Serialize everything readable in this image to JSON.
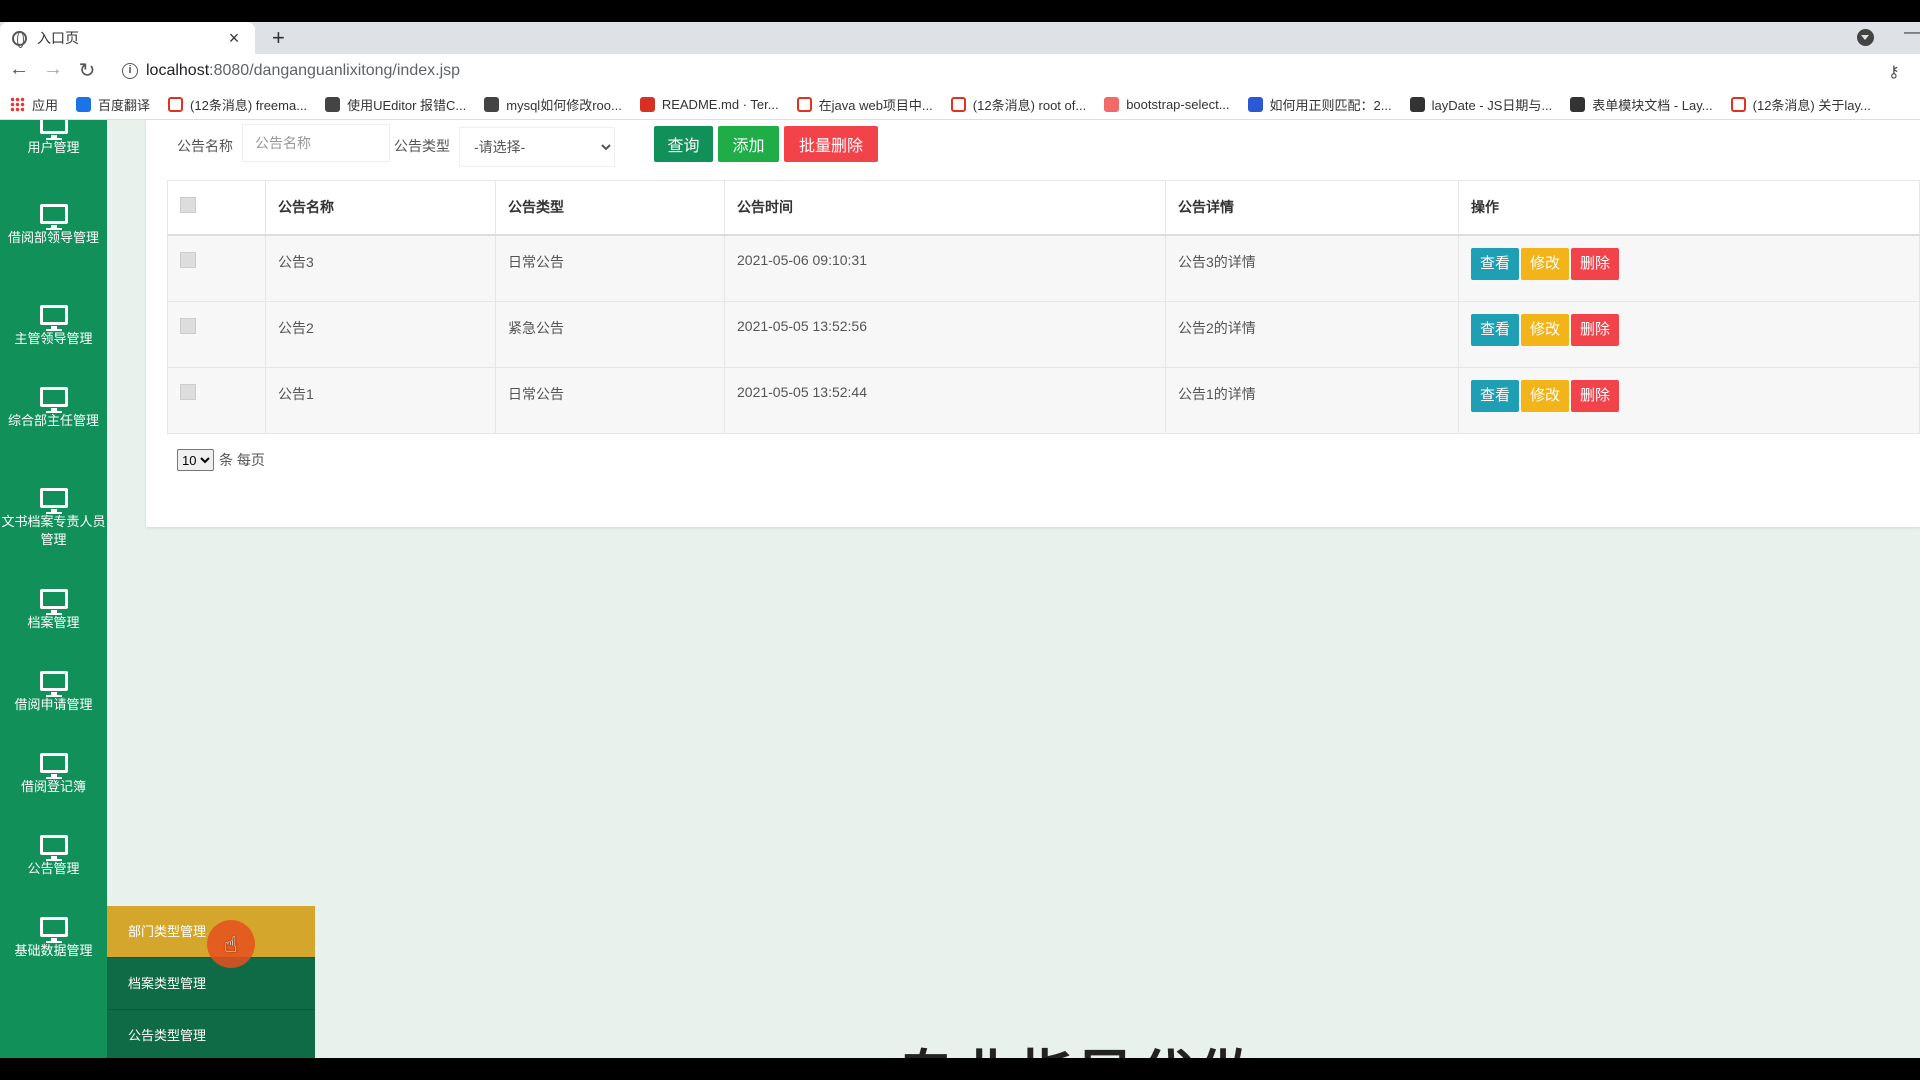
{
  "browser": {
    "tab_title": "入口页",
    "tab_close": "×",
    "new_tab": "+",
    "url_host": "localhost",
    "url_path": ":8080/danganguanlixitong/index.jsp",
    "bookmarks": [
      {
        "label": "应用",
        "icon": "apps-grid-icon"
      },
      {
        "label": "百度翻译",
        "icon": "baidu-translate-icon"
      },
      {
        "label": "(12条消息) freema...",
        "icon": "csdn-icon"
      },
      {
        "label": "使用UEditor 报错C...",
        "icon": "leaf-icon"
      },
      {
        "label": "mysql如何修改roo...",
        "icon": "leaf-icon"
      },
      {
        "label": "README.md · Ter...",
        "icon": "gitee-icon"
      },
      {
        "label": "在java web项目中...",
        "icon": "csdn-icon"
      },
      {
        "label": "(12条消息) root of...",
        "icon": "csdn-icon"
      },
      {
        "label": "bootstrap-select...",
        "icon": "site-icon"
      },
      {
        "label": "如何用正则匹配：2...",
        "icon": "baidu-paw-icon"
      },
      {
        "label": "layDate - JS日期与...",
        "icon": "layui-icon"
      },
      {
        "label": "表单模块文档 - Lay...",
        "icon": "layui-icon"
      },
      {
        "label": "(12条消息) 关于lay...",
        "icon": "csdn-icon"
      }
    ]
  },
  "sidebar": {
    "items": [
      {
        "label": "用户管理"
      },
      {
        "label": "借阅部领导管理"
      },
      {
        "label": "主管领导管理"
      },
      {
        "label": "综合部主任管理"
      },
      {
        "label": "文书档案专责人员管理"
      },
      {
        "label": "档案管理"
      },
      {
        "label": "借阅申请管理"
      },
      {
        "label": "借阅登记簿"
      },
      {
        "label": "公告管理"
      },
      {
        "label": "基础数据管理"
      }
    ],
    "submenu": [
      {
        "label": "部门类型管理"
      },
      {
        "label": "档案类型管理"
      },
      {
        "label": "公告类型管理"
      }
    ]
  },
  "filter": {
    "name_label": "公告名称",
    "name_placeholder": "公告名称",
    "type_label": "公告类型",
    "type_selected": "-请选择-",
    "query_button": "查询",
    "add_button": "添加",
    "batch_delete_button": "批量删除"
  },
  "table": {
    "headers": [
      "公告名称",
      "公告类型",
      "公告时间",
      "公告详情",
      "操作"
    ],
    "rows": [
      {
        "name": "公告3",
        "type": "日常公告",
        "time": "2021-05-06 09:10:31",
        "detail": "公告3的详情"
      },
      {
        "name": "公告2",
        "type": "紧急公告",
        "time": "2021-05-05 13:52:56",
        "detail": "公告2的详情"
      },
      {
        "name": "公告1",
        "type": "日常公告",
        "time": "2021-05-05 13:52:44",
        "detail": "公告1的详情"
      }
    ],
    "actions": {
      "view": "查看",
      "edit": "修改",
      "delete": "删除"
    }
  },
  "pager": {
    "page_size": "10",
    "suffix": "条 每页"
  },
  "watermark": "专业指导代做"
}
